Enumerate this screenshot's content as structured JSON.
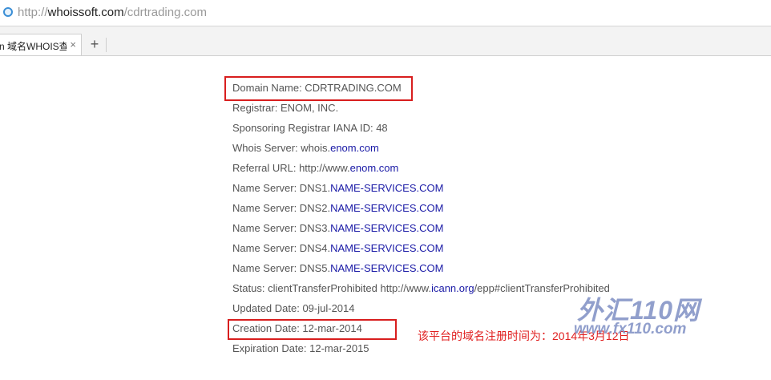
{
  "browser": {
    "url_prefix": "http://",
    "url_host": "whoissoft.com",
    "url_path": "/cdrtrading.com",
    "tab_title": "n 域名WHOIS查",
    "tab_close": "×",
    "new_tab": "+"
  },
  "whois": {
    "domain_name": "Domain Name: CDRTRADING.COM",
    "registrar": "Registrar: ENOM, INC.",
    "iana_id": "Sponsoring Registrar IANA ID: 48",
    "whois_server_label": "Whois Server: whois.",
    "whois_server_link": "enom.com",
    "referral_label": "Referral URL: http://www.",
    "referral_link": "enom.com",
    "ns1_label": "Name Server: DNS1.",
    "ns1_link": "NAME-SERVICES.COM",
    "ns2_label": "Name Server: DNS2.",
    "ns2_link": "NAME-SERVICES.COM",
    "ns3_label": "Name Server: DNS3.",
    "ns3_link": "NAME-SERVICES.COM",
    "ns4_label": "Name Server: DNS4.",
    "ns4_link": "NAME-SERVICES.COM",
    "ns5_label": "Name Server: DNS5.",
    "ns5_link": "NAME-SERVICES.COM",
    "status_label": "Status: clientTransferProhibited http://www.",
    "status_link": "icann.org",
    "status_rest": "/epp#clientTransferProhibited",
    "updated": "Updated Date: 09-jul-2014",
    "creation": "Creation Date: 12-mar-2014",
    "expiration": "Expiration Date: 12-mar-2015"
  },
  "annotation": {
    "note": "该平台的域名注册时间为：2014年3月12日",
    "highlight_color": "#d81e1e"
  },
  "watermark": {
    "cn": "外汇110网",
    "url": "www.fx110.com"
  }
}
